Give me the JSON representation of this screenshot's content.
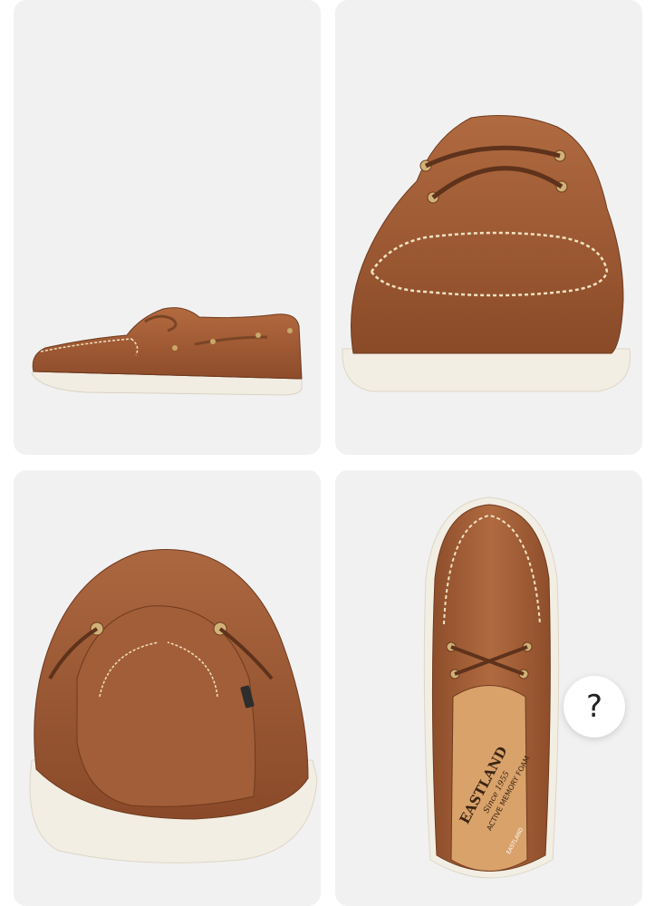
{
  "gallery": {
    "images": [
      {
        "view": "side"
      },
      {
        "view": "front"
      },
      {
        "view": "back"
      },
      {
        "view": "top"
      }
    ],
    "insole": {
      "brand": "EASTLAND",
      "since": "Since 1955",
      "tagline": "ACTIVE MEMORY FOAM",
      "heel_label": "EASTLAND"
    }
  },
  "help_button": {
    "label": "?"
  },
  "colors": {
    "leather": "#a8603a",
    "leather_dark": "#7d4225",
    "sole": "#f3efe4",
    "card_bg": "#f1f1f1"
  }
}
